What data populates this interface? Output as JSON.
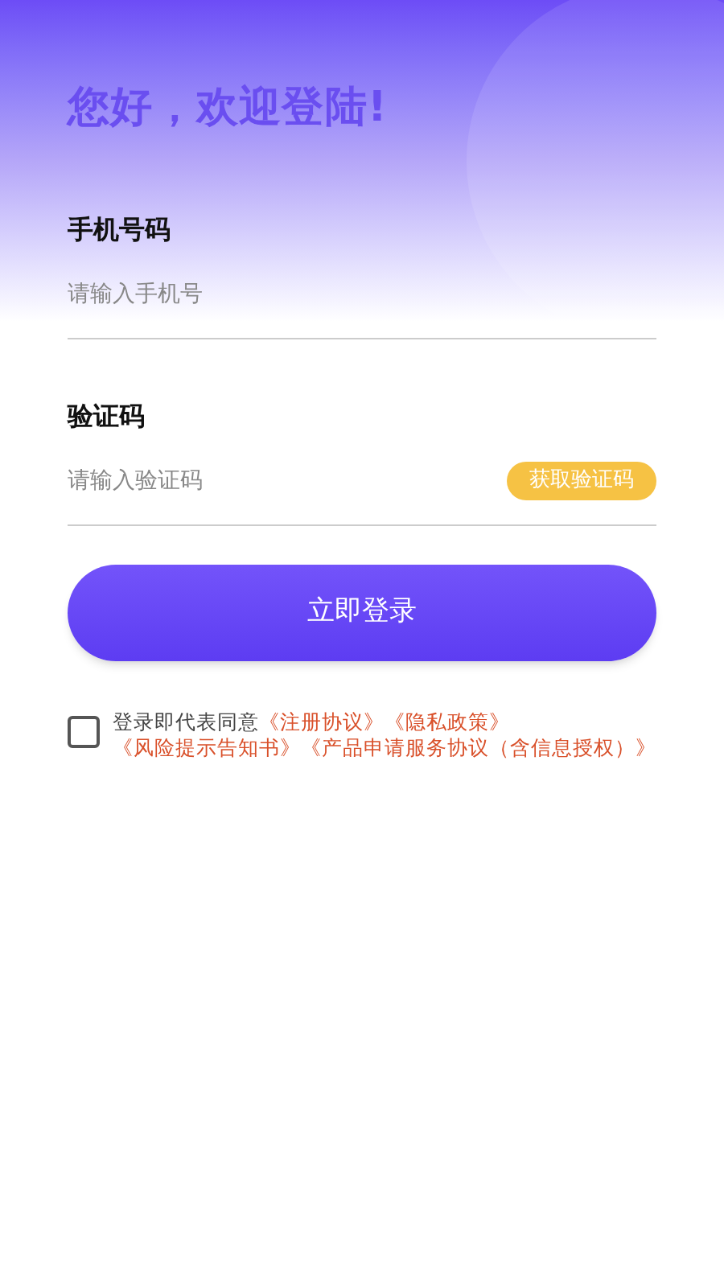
{
  "title": "您好，欢迎登陆!",
  "fields": [
    {
      "kind": "phone",
      "label": "手机号码",
      "placeholder": "请输入手机号"
    },
    {
      "kind": "code",
      "label": "验证码",
      "placeholder": "请输入验证码",
      "action": "获取验证码"
    }
  ],
  "login_button": "立即登录",
  "agreement": {
    "checked": false,
    "text": "登录即代表同意",
    "links": [
      "《注册协议》",
      "《隐私政策》",
      "《风险提示告知书》",
      "《产品申请服务协议（含信息授权）》"
    ]
  }
}
